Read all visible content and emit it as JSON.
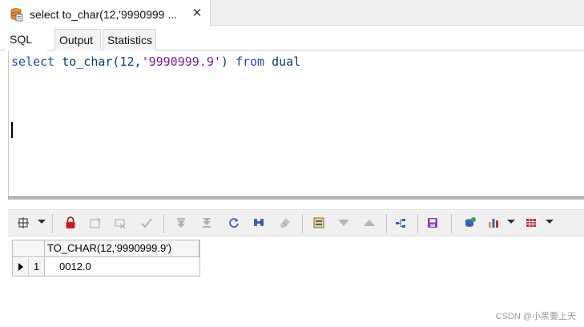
{
  "document_tab": {
    "title": "select to_char(12,'9990999 ...",
    "close_glyph": "✕"
  },
  "sub_tabs": [
    "SQL",
    "Output",
    "Statistics"
  ],
  "editor": {
    "kw_select": "select",
    "code_func": "to_char(12,",
    "code_string": "'9990999.9'",
    "code_paren": ")",
    "kw_from": "from",
    "code_table": "dual"
  },
  "toolbar": {
    "icons": [
      "grid-settings-icon",
      "lock-icon",
      "insert-record-icon",
      "delete-record-icon",
      "post-record-icon",
      "first-record-icon",
      "last-record-icon",
      "refresh-icon",
      "find-icon",
      "clear-icon",
      "single-record-view-icon",
      "previous-record-icon",
      "next-record-icon",
      "query-tree-icon",
      "save-icon",
      "export-icon",
      "chart-icon",
      "grid-options-icon"
    ]
  },
  "grid": {
    "columns": [
      "TO_CHAR(12,'9990999.9')"
    ],
    "rows": [
      {
        "row_number": "1",
        "values": [
          "0012.0"
        ]
      }
    ]
  },
  "colors": {
    "keyword": "#1f4bb0",
    "string": "#7a1fa2",
    "identifier": "#0b3c70"
  },
  "watermark": "CSDN @小黑要上天"
}
